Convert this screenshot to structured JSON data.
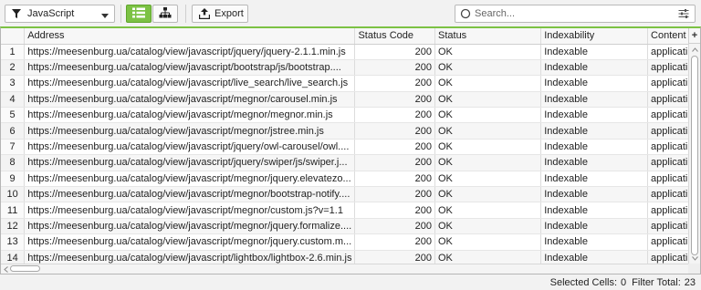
{
  "toolbar": {
    "filter_label": "JavaScript",
    "export_label": "Export",
    "search_placeholder": "Search...",
    "accent_color": "#7cc244"
  },
  "table": {
    "columns": [
      "",
      "Address",
      "Status Code",
      "Status",
      "Indexability",
      "Content T"
    ],
    "add_column_label": "+",
    "rows": [
      [
        "1",
        "https://meesenburg.ua/catalog/view/javascript/jquery/jquery-2.1.1.min.js",
        "200",
        "OK",
        "Indexable",
        "applicati"
      ],
      [
        "2",
        "https://meesenburg.ua/catalog/view/javascript/bootstrap/js/bootstrap....",
        "200",
        "OK",
        "Indexable",
        "applicati"
      ],
      [
        "3",
        "https://meesenburg.ua/catalog/view/javascript/live_search/live_search.js",
        "200",
        "OK",
        "Indexable",
        "applicati"
      ],
      [
        "4",
        "https://meesenburg.ua/catalog/view/javascript/megnor/carousel.min.js",
        "200",
        "OK",
        "Indexable",
        "applicati"
      ],
      [
        "5",
        "https://meesenburg.ua/catalog/view/javascript/megnor/megnor.min.js",
        "200",
        "OK",
        "Indexable",
        "applicati"
      ],
      [
        "6",
        "https://meesenburg.ua/catalog/view/javascript/megnor/jstree.min.js",
        "200",
        "OK",
        "Indexable",
        "applicati"
      ],
      [
        "7",
        "https://meesenburg.ua/catalog/view/javascript/jquery/owl-carousel/owl....",
        "200",
        "OK",
        "Indexable",
        "applicati"
      ],
      [
        "8",
        "https://meesenburg.ua/catalog/view/javascript/jquery/swiper/js/swiper.j...",
        "200",
        "OK",
        "Indexable",
        "applicati"
      ],
      [
        "9",
        "https://meesenburg.ua/catalog/view/javascript/megnor/jquery.elevatezo...",
        "200",
        "OK",
        "Indexable",
        "applicati"
      ],
      [
        "10",
        "https://meesenburg.ua/catalog/view/javascript/megnor/bootstrap-notify....",
        "200",
        "OK",
        "Indexable",
        "applicati"
      ],
      [
        "11",
        "https://meesenburg.ua/catalog/view/javascript/megnor/custom.js?v=1.1",
        "200",
        "OK",
        "Indexable",
        "applicati"
      ],
      [
        "12",
        "https://meesenburg.ua/catalog/view/javascript/megnor/jquery.formalize....",
        "200",
        "OK",
        "Indexable",
        "applicati"
      ],
      [
        "13",
        "https://meesenburg.ua/catalog/view/javascript/megnor/jquery.custom.m...",
        "200",
        "OK",
        "Indexable",
        "applicati"
      ],
      [
        "14",
        "https://meesenburg.ua/catalog/view/javascript/lightbox/lightbox-2.6.min.js",
        "200",
        "OK",
        "Indexable",
        "applicati"
      ]
    ]
  },
  "status_bar": {
    "selected_label": "Selected Cells:",
    "selected_value": "0",
    "filter_label": "Filter Total:",
    "filter_value": "23"
  }
}
